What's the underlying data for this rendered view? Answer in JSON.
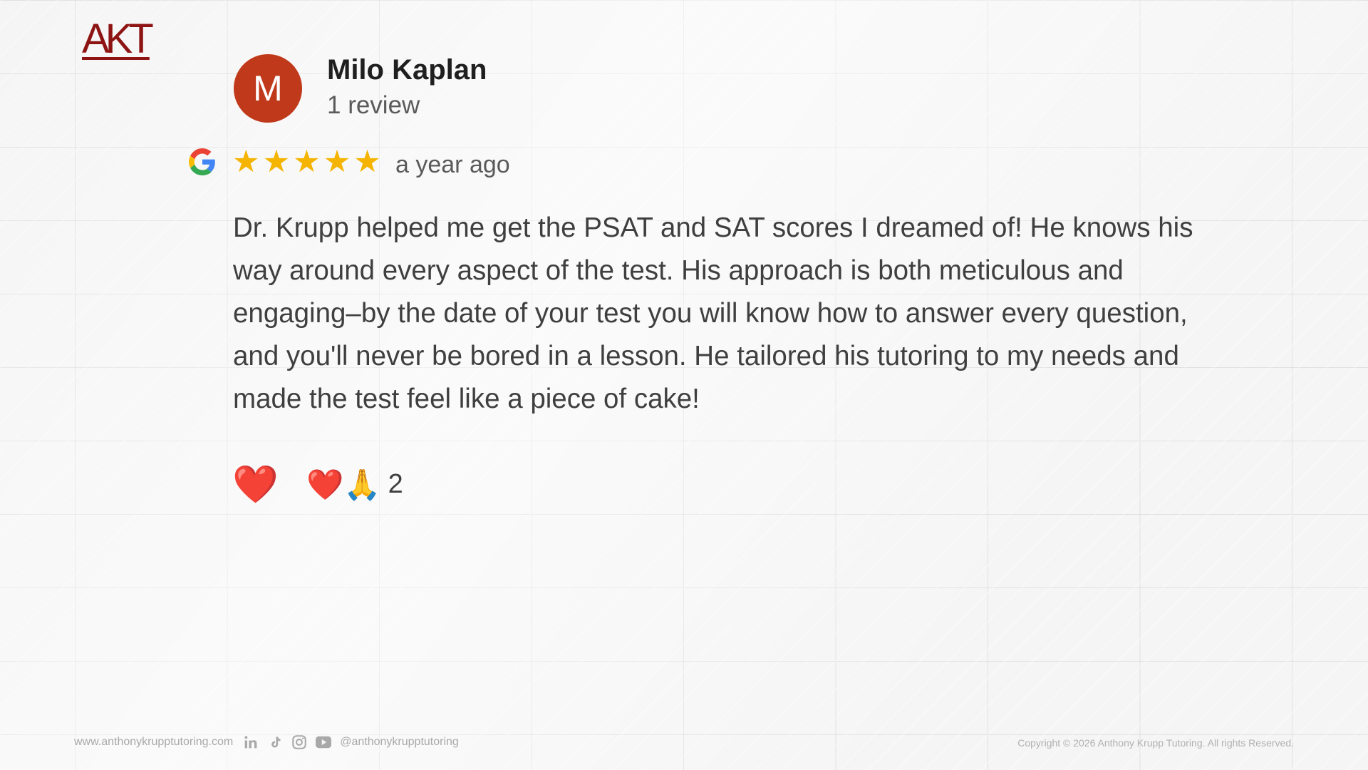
{
  "brand": {
    "logo_text": "AKT",
    "logo_color": "#8e1414"
  },
  "review": {
    "avatar_letter": "M",
    "avatar_color": "#c0391a",
    "reviewer_name": "Milo Kaplan",
    "review_count": "1 review",
    "source_icon": "google-icon",
    "rating": 5,
    "rating_max": 5,
    "time_ago": "a year ago",
    "text": "Dr. Krupp helped me get the PSAT and SAT scores I dreamed of! He knows his way around every aspect of the test. His approach is both meticulous and engaging–by the date of your test you will know how to answer every question, and you'll never be bored in a lesson. He tailored his tutoring to my needs and made the test feel like a piece of cake!",
    "reactions": {
      "heart_button": "❤️",
      "summary_emojis": "❤️🙏",
      "summary_count": "2"
    }
  },
  "footer": {
    "website": "www.anthonykrupptutoring.com",
    "social_icons": [
      "linkedin-icon",
      "tiktok-icon",
      "instagram-icon",
      "youtube-icon"
    ],
    "handle": "@anthonykrupptutoring",
    "copyright": "Copyright © 2026 Anthony Krupp Tutoring. All rights Reserved."
  }
}
